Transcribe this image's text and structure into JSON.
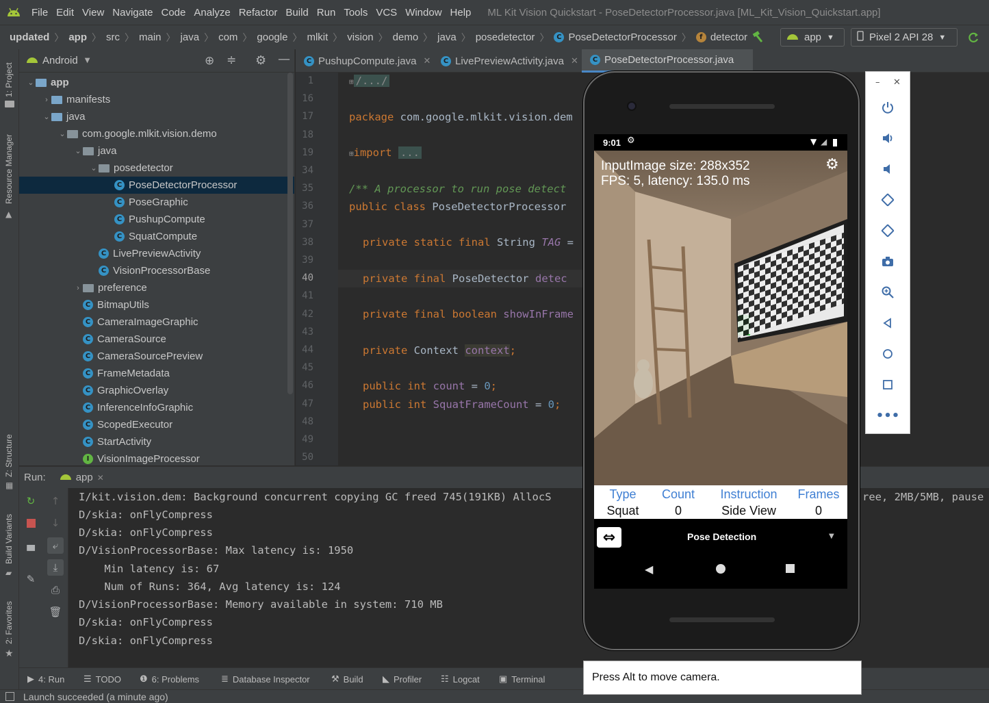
{
  "menu": {
    "items": [
      "File",
      "Edit",
      "View",
      "Navigate",
      "Code",
      "Analyze",
      "Refactor",
      "Build",
      "Run",
      "Tools",
      "VCS",
      "Window",
      "Help"
    ],
    "window_title": "ML Kit Vision Quickstart - PoseDetectorProcessor.java [ML_Kit_Vision_Quickstart.app]"
  },
  "breadcrumb": {
    "items": [
      "updated",
      "app",
      "src",
      "main",
      "java",
      "com",
      "google",
      "mlkit",
      "vision",
      "demo",
      "java",
      "posedetector"
    ],
    "class_name": "PoseDetectorProcessor",
    "field_name": "detector",
    "run_config": "app",
    "device": "Pixel 2 API 28"
  },
  "left_strip": {
    "project": "1: Project",
    "resource_manager": "Resource Manager",
    "structure": "Z: Structure",
    "build_variants": "Build Variants",
    "favorites": "2: Favorites"
  },
  "project_panel": {
    "view_mode": "Android",
    "tree": [
      {
        "label": "app",
        "depth": 0,
        "kind": "module",
        "expanded": true
      },
      {
        "label": "manifests",
        "depth": 1,
        "kind": "folder",
        "expanded": false
      },
      {
        "label": "java",
        "depth": 1,
        "kind": "folder",
        "expanded": true
      },
      {
        "label": "com.google.mlkit.vision.demo",
        "depth": 2,
        "kind": "package",
        "expanded": true
      },
      {
        "label": "java",
        "depth": 3,
        "kind": "package",
        "expanded": true
      },
      {
        "label": "posedetector",
        "depth": 4,
        "kind": "package",
        "expanded": true
      },
      {
        "label": "PoseDetectorProcessor",
        "depth": 5,
        "kind": "class",
        "selected": true
      },
      {
        "label": "PoseGraphic",
        "depth": 5,
        "kind": "class"
      },
      {
        "label": "PushupCompute",
        "depth": 5,
        "kind": "class"
      },
      {
        "label": "SquatCompute",
        "depth": 5,
        "kind": "class"
      },
      {
        "label": "LivePreviewActivity",
        "depth": 4,
        "kind": "activity"
      },
      {
        "label": "VisionProcessorBase",
        "depth": 4,
        "kind": "abstract"
      },
      {
        "label": "preference",
        "depth": 3,
        "kind": "package",
        "expanded": false
      },
      {
        "label": "BitmapUtils",
        "depth": 3,
        "kind": "class"
      },
      {
        "label": "CameraImageGraphic",
        "depth": 3,
        "kind": "class"
      },
      {
        "label": "CameraSource",
        "depth": 3,
        "kind": "class"
      },
      {
        "label": "CameraSourcePreview",
        "depth": 3,
        "kind": "class"
      },
      {
        "label": "FrameMetadata",
        "depth": 3,
        "kind": "class"
      },
      {
        "label": "GraphicOverlay",
        "depth": 3,
        "kind": "class"
      },
      {
        "label": "InferenceInfoGraphic",
        "depth": 3,
        "kind": "class"
      },
      {
        "label": "ScopedExecutor",
        "depth": 3,
        "kind": "class"
      },
      {
        "label": "StartActivity",
        "depth": 3,
        "kind": "activity"
      },
      {
        "label": "VisionImageProcessor",
        "depth": 3,
        "kind": "interface"
      }
    ]
  },
  "editor": {
    "tabs": [
      {
        "label": "PushupCompute.java",
        "active": false
      },
      {
        "label": "LivePreviewActivity.java",
        "active": false
      },
      {
        "label": "PoseDetectorProcessor.java",
        "active": true
      }
    ],
    "line_numbers": [
      "1",
      "16",
      "17",
      "18",
      "19",
      "34",
      "35",
      "36",
      "37",
      "38",
      "39",
      "40",
      "41",
      "42",
      "43",
      "44",
      "45",
      "46",
      "47",
      "48",
      "49",
      "50"
    ],
    "current_line": "40",
    "code": {
      "l1": "/.../",
      "l17_kw": "package",
      "l17_rest": " com.google.mlkit.vision.dem",
      "l19_kw": "import",
      "l19_fold": "...",
      "l35": "/** A processor to run pose detect",
      "l36_kw": "public class",
      "l36_rest": " PoseDetectorProcessor",
      "l38_kw": "private static final",
      "l38_type": " String ",
      "l38_const": "TAG",
      "l38_tail": " =",
      "l40_kw": "private final",
      "l40_type": " PoseDetector ",
      "l40_field": "detec",
      "l42_kw": "private final boolean",
      "l42_field": " showInFrame",
      "l44_kw": "private",
      "l44_type": " Context ",
      "l44_field": "context",
      "l44_tail": ";",
      "l46_kw": "public int",
      "l46_field": " count",
      "l46_eq": " = ",
      "l46_num": "0",
      "l46_tail": ";",
      "l47_kw": "public int",
      "l47_field": " SquatFrameCount",
      "l47_eq": " = ",
      "l47_num": "0",
      "l47_tail": ";"
    }
  },
  "run_panel": {
    "label": "Run:",
    "config": "app",
    "log": [
      "I/kit.vision.dem: Background concurrent copying GC freed 745(191KB) AllocS",
      "D/skia: onFlyCompress",
      "D/skia: onFlyCompress",
      "D/VisionProcessorBase: Max latency is: 1950",
      "    Min latency is: 67",
      "    Num of Runs: 364, Avg latency is: 124",
      "D/VisionProcessorBase: Memory available in system: 710 MB",
      "D/skia: onFlyCompress",
      "D/skia: onFlyCompress"
    ],
    "log_overflow_right": "ree, 2MB/5MB, pause"
  },
  "bottom_tools": [
    {
      "label": "4: Run",
      "icon": "play-icon"
    },
    {
      "label": "TODO",
      "icon": "list-icon"
    },
    {
      "label": "6: Problems",
      "icon": "info-icon"
    },
    {
      "label": "Database Inspector",
      "icon": "database-icon"
    },
    {
      "label": "Build",
      "icon": "hammer-icon"
    },
    {
      "label": "Profiler",
      "icon": "profiler-icon"
    },
    {
      "label": "Logcat",
      "icon": "logcat-icon"
    },
    {
      "label": "Terminal",
      "icon": "terminal-icon"
    }
  ],
  "status": "Launch succeeded (a minute ago)",
  "emulator": {
    "status_time": "9:01",
    "overlay_line1": "InputImage size: 288x352",
    "overlay_line2": "FPS: 5, latency: 135.0 ms",
    "table": {
      "headers": [
        "Type",
        "Count",
        "Instruction",
        "Frames"
      ],
      "values": [
        "Squat",
        "0",
        "Side View",
        "0"
      ]
    },
    "spinner_label": "Pose Detection",
    "hint": "Press Alt to move camera.",
    "tools": [
      "power-icon",
      "volume-up-icon",
      "volume-down-icon",
      "rotate-left-icon",
      "rotate-right-icon",
      "camera-icon",
      "zoom-icon",
      "back-icon",
      "home-icon",
      "overview-icon",
      "more-icon"
    ]
  },
  "colors": {
    "accent": "#4a88c7",
    "keyword": "#cc7832",
    "field": "#9876aa",
    "comment": "#629755",
    "number": "#6897bb",
    "table_header": "#3f7fd3",
    "android_green": "#a4c639"
  }
}
